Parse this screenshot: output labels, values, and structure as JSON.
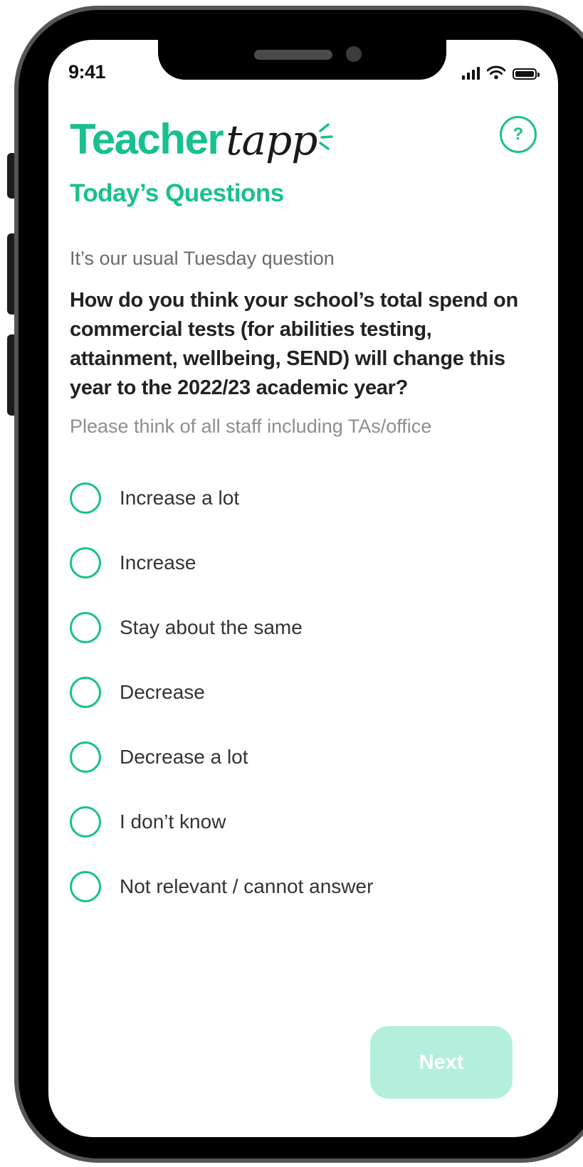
{
  "status_bar": {
    "time": "9:41",
    "icons": [
      "signal-icon",
      "wifi-icon",
      "battery-icon"
    ]
  },
  "app": {
    "logo_main": "Teacher",
    "logo_script": "tapp",
    "help_label": "?"
  },
  "page": {
    "title": "Today’s Questions",
    "intro": "It’s our usual Tuesday question",
    "question": "How do you think your school’s total spend on commercial tests (for abilities testing, attainment, wellbeing, SEND) will change this year to the 2022/23 academic year?",
    "hint": "Please think of all staff including TAs/office"
  },
  "options": [
    {
      "label": "Increase a lot",
      "selected": false
    },
    {
      "label": "Increase",
      "selected": false
    },
    {
      "label": "Stay about the same",
      "selected": false
    },
    {
      "label": "Decrease",
      "selected": false
    },
    {
      "label": "Decrease a lot",
      "selected": false
    },
    {
      "label": "I don’t know",
      "selected": false
    },
    {
      "label": "Not relevant / cannot answer",
      "selected": false
    }
  ],
  "actions": {
    "next_label": "Next",
    "next_enabled": false
  },
  "colors": {
    "brand_green": "#19c08f",
    "button_disabled": "#b3efdc",
    "text_dark": "#222222",
    "text_muted": "#8e8e8e"
  }
}
